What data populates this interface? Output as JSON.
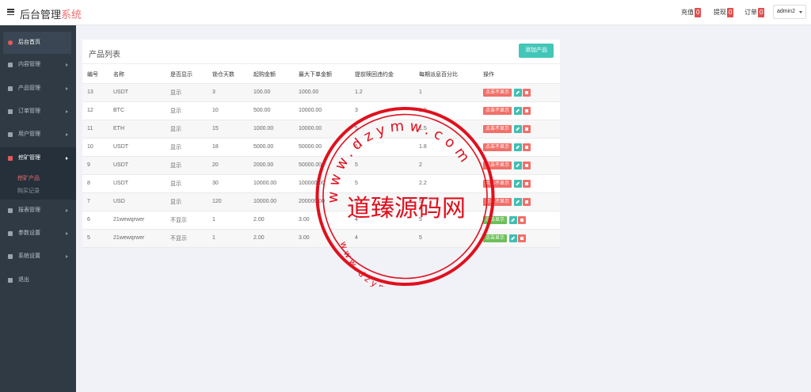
{
  "header": {
    "brand_main": "后台管理",
    "brand_accent": "系统",
    "recharge_label": "充值",
    "recharge_count": "0",
    "withdraw_label": "提现",
    "withdraw_count": "0",
    "orders_label": "订单",
    "orders_count": "0",
    "user": "admin2"
  },
  "sidebar": {
    "items": [
      {
        "label": "后台首页"
      },
      {
        "label": "内容管理"
      },
      {
        "label": "产品管理"
      },
      {
        "label": "订单管理"
      },
      {
        "label": "用户管理"
      },
      {
        "label": "挖矿管理"
      },
      {
        "label": "报表管理"
      },
      {
        "label": "参数设置"
      },
      {
        "label": "系统设置"
      },
      {
        "label": "退出"
      }
    ],
    "submenu": [
      {
        "label": "挖矿产品"
      },
      {
        "label": "购买记录"
      }
    ]
  },
  "panel": {
    "title": "产品列表",
    "add_button": "添加产品"
  },
  "table": {
    "headers": [
      "编号",
      "名称",
      "是否显示",
      "锁仓天数",
      "起购金额",
      "最大下单金额",
      "提前赎回违约金",
      "每期派息百分比",
      "操作"
    ],
    "rows": [
      {
        "id": "13",
        "name": "USDT",
        "show": "显示",
        "lock": "3",
        "min": "100.00",
        "max": "1000.00",
        "early": "1.2",
        "rate": "1",
        "toggle": "点击不显示",
        "state": "red"
      },
      {
        "id": "12",
        "name": "BTC",
        "show": "显示",
        "lock": "10",
        "min": "500.00",
        "max": "10000.00",
        "early": "3",
        "rate": "1.2",
        "toggle": "点击不显示",
        "state": "red"
      },
      {
        "id": "11",
        "name": "ETH",
        "show": "显示",
        "lock": "15",
        "min": "1000.00",
        "max": "10000.00",
        "early": "5",
        "rate": "1.5",
        "toggle": "点击不显示",
        "state": "red"
      },
      {
        "id": "10",
        "name": "USDT",
        "show": "显示",
        "lock": "18",
        "min": "5000.00",
        "max": "50000.00",
        "early": "5",
        "rate": "1.8",
        "toggle": "点击不显示",
        "state": "red"
      },
      {
        "id": "9",
        "name": "USDT",
        "show": "显示",
        "lock": "20",
        "min": "2000.00",
        "max": "50000.00",
        "early": "5",
        "rate": "2",
        "toggle": "点击不显示",
        "state": "red"
      },
      {
        "id": "8",
        "name": "USDT",
        "show": "显示",
        "lock": "30",
        "min": "10000.00",
        "max": "100000.00",
        "early": "5",
        "rate": "2.2",
        "toggle": "点击不显示",
        "state": "red"
      },
      {
        "id": "7",
        "name": "USD",
        "show": "显示",
        "lock": "120",
        "min": "10000.00",
        "max": "200000.00",
        "early": "5",
        "rate": "5",
        "toggle": "点击不显示",
        "state": "red"
      },
      {
        "id": "6",
        "name": "21wewqrwer",
        "show": "不显示",
        "lock": "1",
        "min": "2.00",
        "max": "3.00",
        "early": "4",
        "rate": "5",
        "toggle": "点击显示",
        "state": "green"
      },
      {
        "id": "5",
        "name": "21wewqrwer",
        "show": "不显示",
        "lock": "1",
        "min": "2.00",
        "max": "3.00",
        "early": "4",
        "rate": "5",
        "toggle": "点击显示",
        "state": "green"
      }
    ]
  },
  "watermark": {
    "center_text": "道臻源码网",
    "ring_text": "www.dzymw.com"
  },
  "colors": {
    "accent": "#f06e6e",
    "sidebar_bg": "#2f3a45",
    "primary_button": "#42c6b8",
    "stamp": "#e0101e"
  }
}
